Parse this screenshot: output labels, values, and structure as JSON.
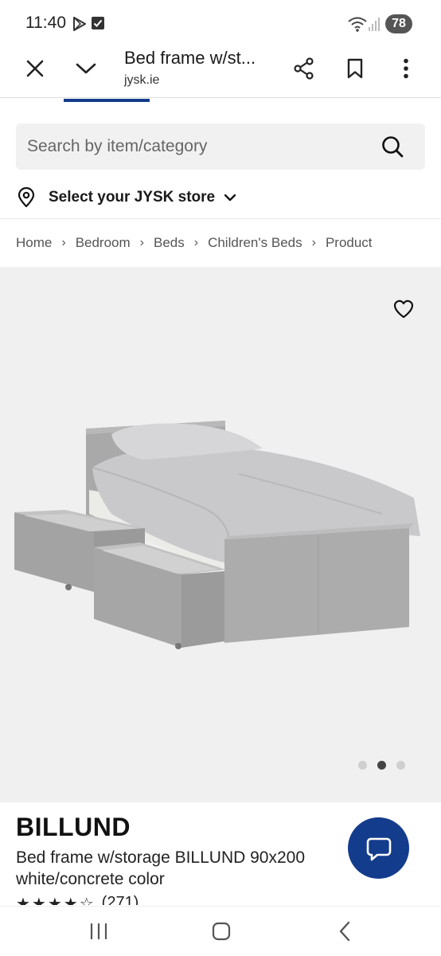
{
  "status_bar": {
    "time": "11:40",
    "battery": "78"
  },
  "browser": {
    "page_title": "Bed frame w/st...",
    "url": "jysk.ie"
  },
  "search": {
    "placeholder": "Search by item/category"
  },
  "store": {
    "label": "Select your JYSK store"
  },
  "breadcrumb": [
    "Home",
    "Bedroom",
    "Beds",
    "Children's Beds",
    "Product"
  ],
  "gallery": {
    "slide_count": 3,
    "active_slide": 2
  },
  "product": {
    "name": "BILLUND",
    "description": "Bed frame w/storage BILLUND 90x200 white/concrete color",
    "rating_stars": "★★★★☆",
    "rating_value": 4,
    "review_count": "(271)"
  },
  "colors": {
    "brand_blue": "#143c8c",
    "gallery_bg": "#f0f0f0",
    "search_bg": "#f1f1f1"
  },
  "icons": {
    "status": [
      "play-store-icon",
      "checkbox-icon",
      "wifi-icon",
      "signal-icon"
    ],
    "toolbar": [
      "close-icon",
      "chevron-down-icon",
      "share-icon",
      "bookmark-icon",
      "more-vert-icon"
    ],
    "page": [
      "search-icon",
      "location-pin-icon",
      "chevron-down-icon",
      "heart-icon",
      "chat-icon"
    ],
    "system_nav": [
      "recents-icon",
      "home-icon",
      "back-icon"
    ]
  }
}
